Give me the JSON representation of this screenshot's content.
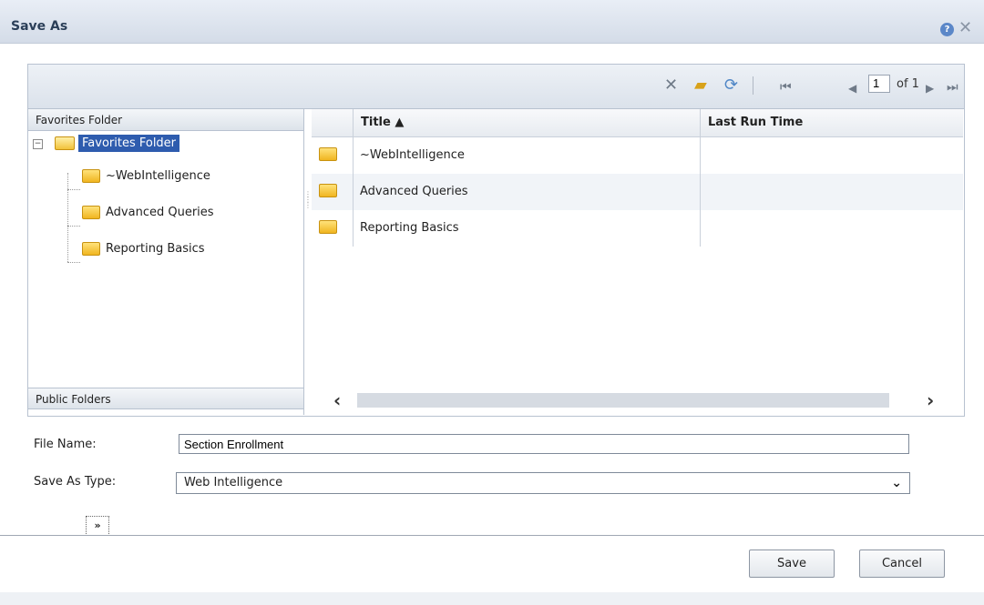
{
  "dialog": {
    "title": "Save As",
    "help_icon": "help-icon",
    "close_icon": "close-icon"
  },
  "toolbar": {
    "icons": [
      "delete-icon",
      "new-folder-icon",
      "refresh-icon",
      "first-page-icon",
      "previous-page-icon",
      "next-page-icon",
      "last-page-icon"
    ],
    "page_value": "1",
    "page_of": "of 1"
  },
  "left_panel": {
    "favorites_header": "Favorites Folder",
    "public_header": "Public Folders",
    "tree": {
      "root": "Favorites Folder",
      "children": [
        "~WebIntelligence",
        "Advanced Queries",
        "Reporting Basics"
      ]
    }
  },
  "grid": {
    "columns": [
      "Title ▲",
      "Last Run Time"
    ],
    "rows": [
      {
        "title": "~WebIntelligence",
        "last_run": ""
      },
      {
        "title": "Advanced Queries",
        "last_run": ""
      },
      {
        "title": "Reporting Basics",
        "last_run": ""
      }
    ]
  },
  "form": {
    "file_name_label": "File Name:",
    "file_name_value": "Section Enrollment",
    "save_type_label": "Save As Type:",
    "save_type_value": "Web Intelligence"
  },
  "footer": {
    "expand_label": "»",
    "save_label": "Save",
    "cancel_label": "Cancel"
  },
  "colors": {
    "selection": "#2e5cae",
    "folder": "#f0b520",
    "title_text": "#2b3f58"
  }
}
